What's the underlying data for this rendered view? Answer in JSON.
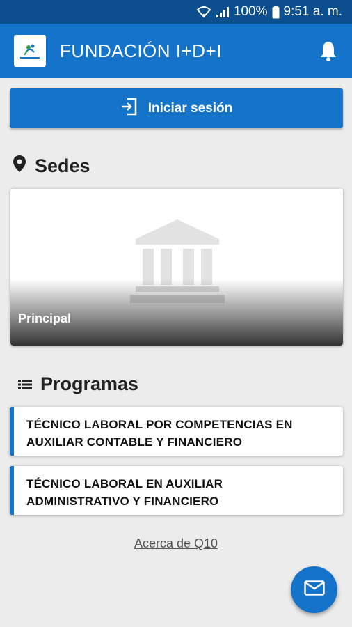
{
  "status_bar": {
    "battery": "100%",
    "time": "9:51 a. m.",
    "icons": [
      "wifi-icon",
      "signal-icon",
      "battery-icon"
    ]
  },
  "app_bar": {
    "logo_text": "FUNDACIÓN I+D+I",
    "title": "FUNDACIÓN I+D+I",
    "bell_icon": "bell-icon"
  },
  "login": {
    "label": "Iniciar sesión",
    "icon": "login-icon"
  },
  "sedes": {
    "heading": "Sedes",
    "icon": "location-pin-icon",
    "items": [
      {
        "name": "Principal",
        "image_icon": "building-icon"
      }
    ]
  },
  "programas": {
    "heading": "Programas",
    "icon": "list-icon",
    "items": [
      {
        "line1": "TÉCNICO LABORAL POR COMPETENCIAS EN",
        "line2": "AUXILIAR CONTABLE Y FINANCIERO"
      },
      {
        "line1": "TÉCNICO LABORAL EN AUXILIAR",
        "line2": "ADMINISTRATIVO Y FINANCIERO"
      }
    ]
  },
  "footer": {
    "about_link": "Acerca de Q10"
  },
  "fab": {
    "icon": "mail-icon"
  },
  "colors": {
    "primary": "#1574c9",
    "status_bar": "#0b4f8f",
    "background": "#ececec"
  }
}
